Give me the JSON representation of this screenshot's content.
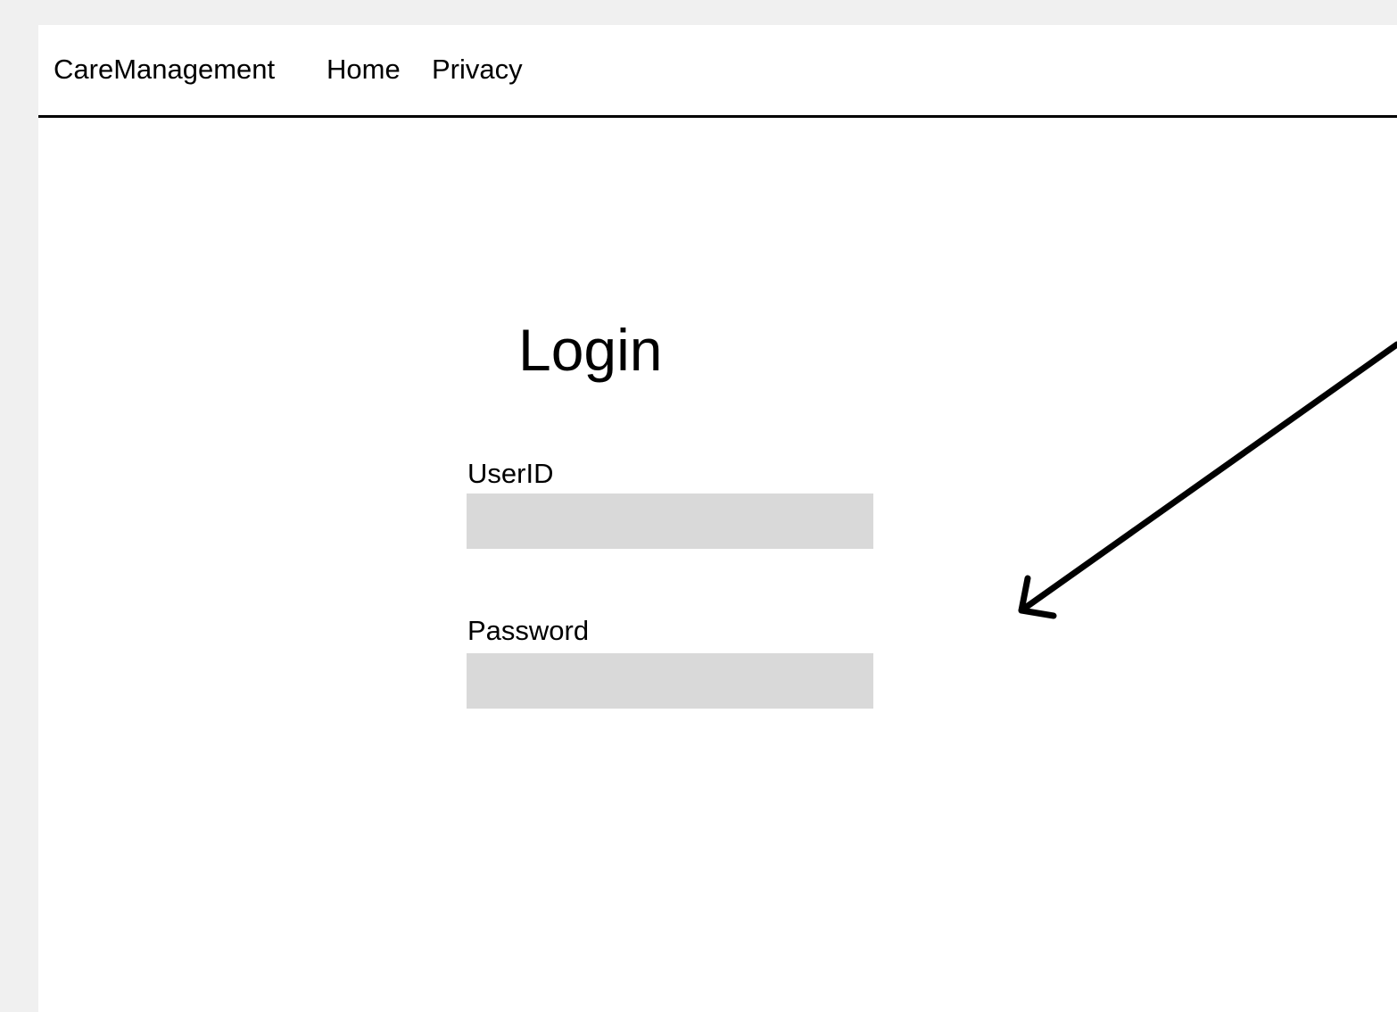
{
  "navbar": {
    "brand": "CareManagement",
    "links": [
      {
        "label": "Home"
      },
      {
        "label": "Privacy"
      }
    ]
  },
  "login": {
    "title": "Login",
    "userid_label": "UserID",
    "userid_value": "",
    "password_label": "Password",
    "password_value": ""
  },
  "annotation": {
    "icon": "arrow-pointer-icon",
    "color": "#000000"
  },
  "colors": {
    "page_background": "#f0f0f0",
    "frame_background": "#ffffff",
    "input_background": "#d9d9d9",
    "navbar_border": "#000000"
  }
}
